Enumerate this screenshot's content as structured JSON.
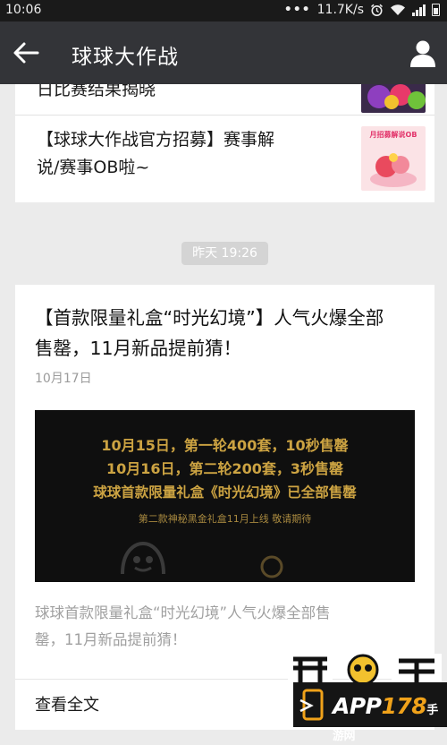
{
  "status_bar": {
    "time": "10:06",
    "dots": "•••",
    "speed": "11.7K/s"
  },
  "nav": {
    "title": "球球大作战",
    "back_icon": "arrow-left-icon",
    "profile_icon": "person-icon"
  },
  "top_list": [
    {
      "text": "日比赛结果揭晓"
    },
    {
      "text_line1": "【球球大作战官方招募】赛事解",
      "text_line2": "说/赛事OB啦~",
      "thumb_caption": "月招募解说OB"
    }
  ],
  "timestamp_pill": "昨天 19:26",
  "article": {
    "title_line1": "【首款限量礼盒“时光幻境”】人气火爆全部",
    "title_line2": "售罄，11月新品提前猜！",
    "date": "10月17日",
    "banner": {
      "line1": "10月15日，第一轮400套，10秒售罄",
      "line2": "10月16日，第二轮200套，3秒售罄",
      "line3": "球球首款限量礼盒《时光幻境》已全部售罄",
      "sub": "第二款神秘黑金礼盒11月上线 敬请期待"
    },
    "summary_line1": "球球首款限量礼盒“时光幻境”人气火爆全部售",
    "summary_line2": "罄，11月新品提前猜！",
    "read_more": "查看全文"
  },
  "watermark": {
    "app": "APP",
    "num": "178",
    "suffix": "手游网",
    "suffix2": "•"
  },
  "colors": {
    "nav_bg": "#333438",
    "status_bg": "#1a1a1a",
    "page_bg": "#ebebeb",
    "banner_gold": "#cca342"
  }
}
